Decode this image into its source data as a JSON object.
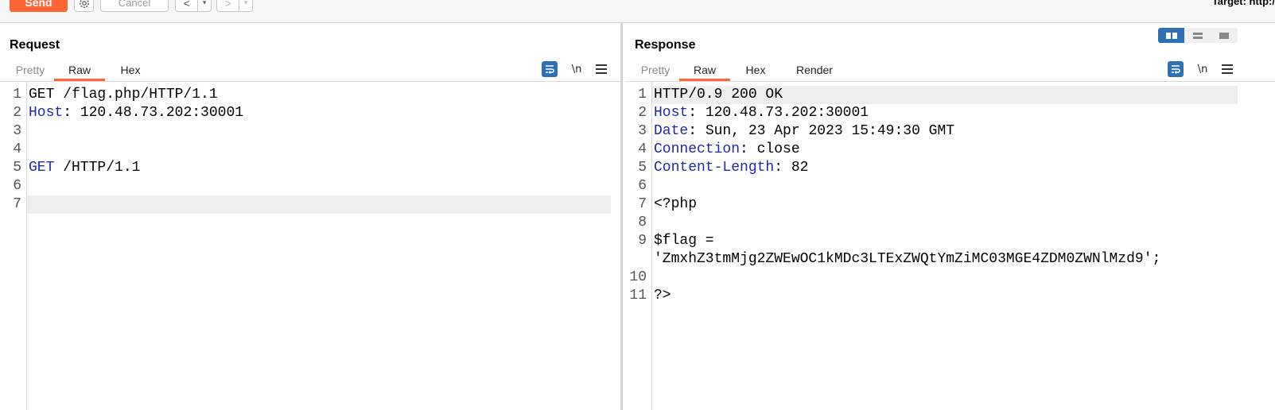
{
  "toolbar": {
    "send_label": "Send",
    "cancel_label": "Cancel",
    "back_glyph": "<",
    "forward_glyph": ">",
    "dropdown_glyph": "▾",
    "target_label": "Target: http:/"
  },
  "request": {
    "title": "Request",
    "tabs": [
      "Pretty",
      "Raw",
      "Hex"
    ],
    "active_tab": "Raw",
    "newline_label": "\\n",
    "lines": [
      {
        "n": "1",
        "key": "",
        "rest": "GET /flag.php/HTTP/1.1"
      },
      {
        "n": "2",
        "key": "Host",
        "rest": ": 120.48.73.202:30001"
      },
      {
        "n": "3",
        "key": "",
        "rest": ""
      },
      {
        "n": "4",
        "key": "",
        "rest": ""
      },
      {
        "n": "5",
        "key": "GET",
        "rest": " /HTTP/1.1"
      },
      {
        "n": "6",
        "key": "",
        "rest": ""
      },
      {
        "n": "7",
        "key": "",
        "rest": ""
      }
    ]
  },
  "response": {
    "title": "Response",
    "tabs": [
      "Pretty",
      "Raw",
      "Hex",
      "Render"
    ],
    "active_tab": "Raw",
    "newline_label": "\\n",
    "lines": [
      {
        "n": "1",
        "key": "",
        "rest": "HTTP/0.9 200 OK"
      },
      {
        "n": "2",
        "key": "Host",
        "rest": ": 120.48.73.202:30001"
      },
      {
        "n": "3",
        "key": "Date",
        "rest": ": Sun, 23 Apr 2023 15:49:30 GMT"
      },
      {
        "n": "4",
        "key": "Connection",
        "rest": ": close"
      },
      {
        "n": "5",
        "key": "Content-Length",
        "rest": ": 82"
      },
      {
        "n": "6",
        "key": "",
        "rest": ""
      },
      {
        "n": "7",
        "key": "",
        "rest": "<?php"
      },
      {
        "n": "8",
        "key": "",
        "rest": ""
      },
      {
        "n": "9",
        "key": "",
        "rest": "$flag ="
      },
      {
        "n": "",
        "key": "",
        "rest": "'ZmxhZ3tmMjg2ZWEwOC1kMDc3LTExZWQtYmZiMC03MGE4ZDM0ZWNlMzd9';"
      },
      {
        "n": "10",
        "key": "",
        "rest": ""
      },
      {
        "n": "11",
        "key": "",
        "rest": "?>"
      }
    ]
  },
  "colors": {
    "accent": "#ff6633",
    "keyword": "#1f2aa3",
    "icon_blue": "#2f6fb3"
  }
}
